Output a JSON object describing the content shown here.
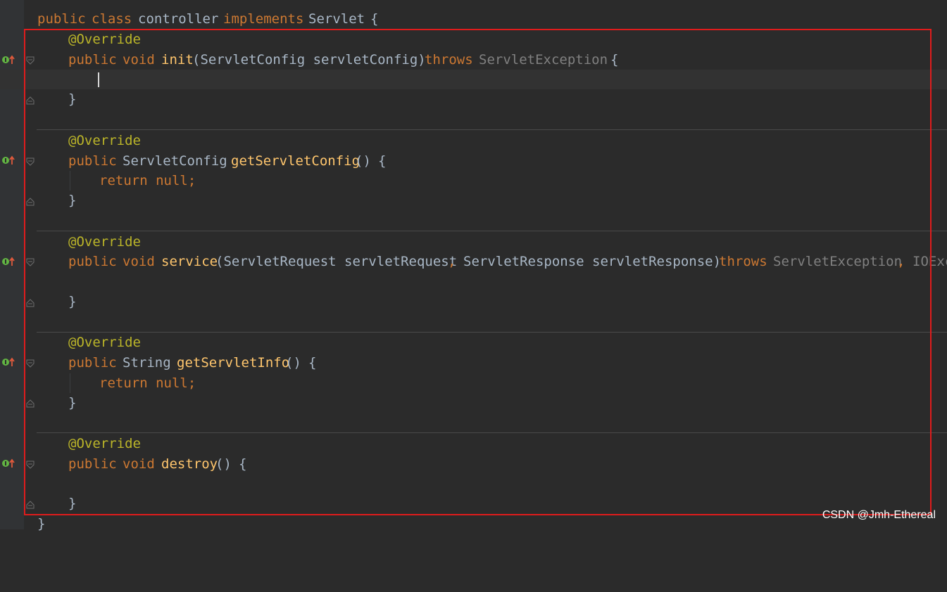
{
  "colors": {
    "background": "#2b2b2b",
    "gutter": "#313335",
    "keyword": "#cc7832",
    "annotation": "#bbb529",
    "method": "#ffc66d",
    "text": "#a9b7c6",
    "exception": "#808080",
    "highlight_box": "#e01c1c"
  },
  "code": {
    "class_decl": {
      "public": "public",
      "class": "class",
      "name": "controller",
      "implements": "implements",
      "iface": "Servlet",
      "brace": "{"
    },
    "init": {
      "annotation": "@Override",
      "public": "public",
      "void": "void",
      "name": "init",
      "params": "(ServletConfig servletConfig)",
      "throws": "throws",
      "exception": "ServletException",
      "brace": "{",
      "close": "}"
    },
    "get_config": {
      "annotation": "@Override",
      "public": "public",
      "type": "ServletConfig",
      "name": "getServletConfig",
      "params": "()",
      "brace": "{",
      "body": "return null;",
      "close": "}"
    },
    "service": {
      "annotation": "@Override",
      "public": "public",
      "void": "void",
      "name": "service",
      "params": "(ServletRequest servletRequest",
      "comma": ",",
      "params2": "ServletResponse servletResponse)",
      "throws": "throws",
      "exception": "ServletException",
      "comma2": ",",
      "exception2": "IOExc",
      "close": "}"
    },
    "get_info": {
      "annotation": "@Override",
      "public": "public",
      "type": "String",
      "name": "getServletInfo",
      "params": "()",
      "brace": "{",
      "body": "return null;",
      "close": "}"
    },
    "destroy": {
      "annotation": "@Override",
      "public": "public",
      "void": "void",
      "name": "destroy",
      "params": "()",
      "brace": "{",
      "close": "}"
    },
    "class_close": "}"
  },
  "gutter": {
    "override_icon": "implements-method-icon",
    "fold_icon": "fold-marker-icon"
  },
  "watermark": "CSDN @Jmh-Ethereal"
}
